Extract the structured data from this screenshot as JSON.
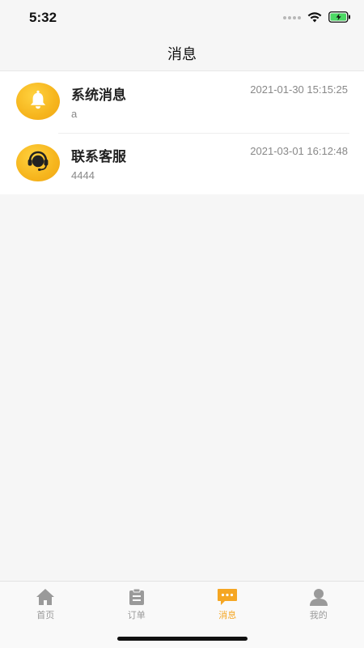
{
  "status_bar": {
    "time": "5:32",
    "battery_color": "#4cd964"
  },
  "nav": {
    "title": "消息"
  },
  "messages": [
    {
      "title": "系统消息",
      "time": "2021-01-30 15:15:25",
      "preview": "a",
      "icon": "bell-icon"
    },
    {
      "title": "联系客服",
      "time": "2021-03-01 16:12:48",
      "preview": "4444",
      "icon": "headset-icon"
    }
  ],
  "tabs": [
    {
      "label": "首页",
      "icon": "home-icon",
      "active": false
    },
    {
      "label": "订单",
      "icon": "clipboard-icon",
      "active": false
    },
    {
      "label": "消息",
      "icon": "chat-icon",
      "active": true
    },
    {
      "label": "我的",
      "icon": "user-icon",
      "active": false
    }
  ],
  "colors": {
    "accent": "#f5a623",
    "avatar_yellow": "#f6b51d",
    "inactive_tab": "#9a9a9a"
  }
}
